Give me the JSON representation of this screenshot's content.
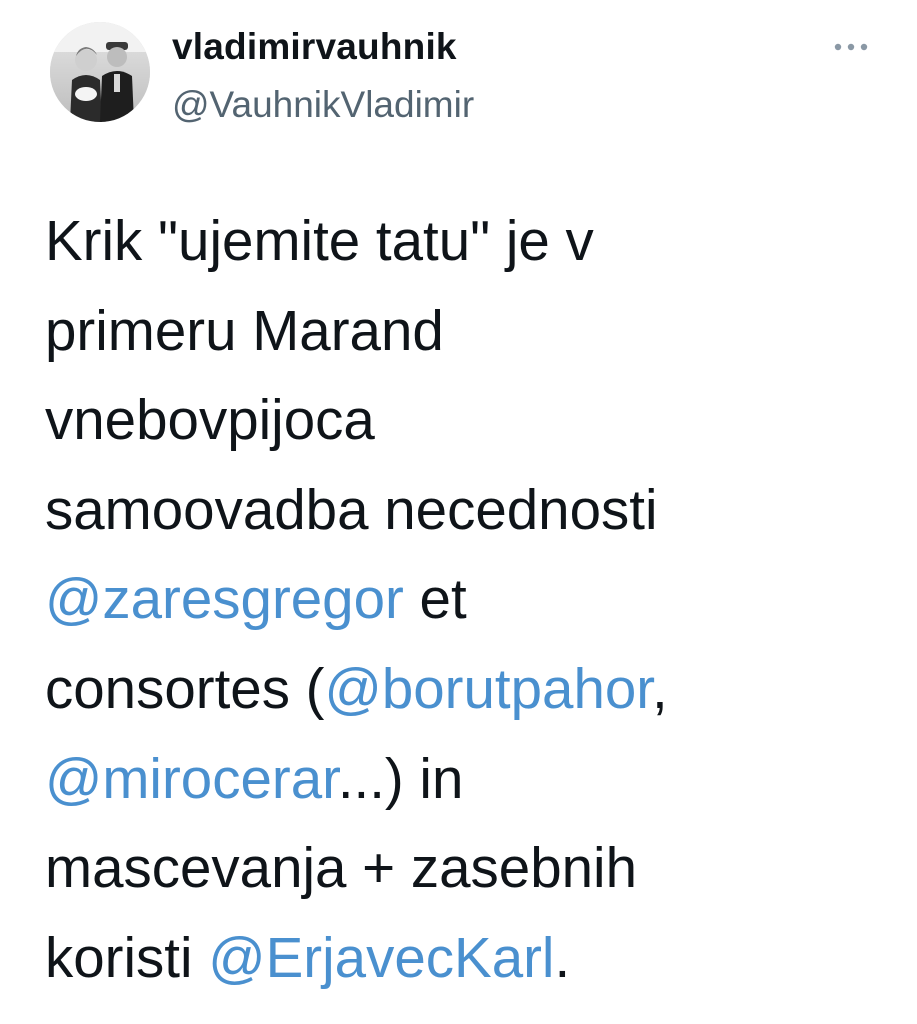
{
  "tweet": {
    "author": {
      "display_name": "vladimirvauhnik",
      "handle": "@VauhnikVladimir"
    },
    "more_icon": "more-horizontal-icon",
    "text_lines": [
      [
        {
          "text": "Krik \"ujemite tatu\" je v"
        }
      ],
      [
        {
          "text": "primeru Marand"
        }
      ],
      [
        {
          "text": "vnebovpijoca"
        }
      ],
      [
        {
          "text": "samoovadba necednosti"
        }
      ],
      [
        {
          "text": "@zaresgregor",
          "mention": true
        },
        {
          "text": " et"
        }
      ],
      [
        {
          "text": "consortes ("
        },
        {
          "text": "@borutpahor",
          "mention": true
        },
        {
          "text": ","
        }
      ],
      [
        {
          "text": "@mirocerar",
          "mention": true
        },
        {
          "text": "...) in"
        }
      ],
      [
        {
          "text": "mascevanja + zasebnih"
        }
      ],
      [
        {
          "text": "koristi "
        },
        {
          "text": "@ErjavecKarl",
          "mention": true
        },
        {
          "text": "."
        }
      ]
    ]
  },
  "colors": {
    "text": "#0f1419",
    "secondary": "#536471",
    "link": "#4a90cf",
    "background": "#ffffff"
  }
}
